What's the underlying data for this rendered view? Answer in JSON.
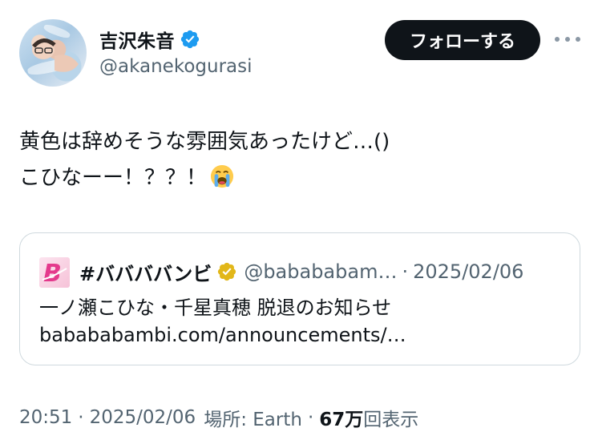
{
  "author": {
    "display_name": "吉沢朱音",
    "handle": "@akanekogurasi",
    "avatar_icon": "profile-photo",
    "verified_icon": "verified-badge-icon",
    "verified_color": "#1d9bf0"
  },
  "follow_button": {
    "label": "フォローする"
  },
  "more_menu": {
    "icon": "more-horizontal-icon"
  },
  "tweet": {
    "line1": "黄色は辞めそうな雰囲気あったけど…()",
    "line2": "こひなーー！？？！",
    "emoji": "loudly-crying-face-icon"
  },
  "quoted_tweet": {
    "display_name": "#ババババンビ",
    "handle": "@babababam…",
    "separator": "·",
    "date": "2025/02/06",
    "badge_icon": "gold-verified-badge-icon",
    "badge_color": "#e2b719",
    "logo_icon": "bababa-bambi-logo",
    "line1": "一ノ瀬こひな・千星真穂 脱退のお知らせ",
    "line2": "babababambi.com/announcements/…"
  },
  "meta": {
    "time": "20:51",
    "sep": "·",
    "date": "2025/02/06",
    "location": "場所: Earth",
    "views_count": "67万",
    "views_label": "回表示"
  }
}
